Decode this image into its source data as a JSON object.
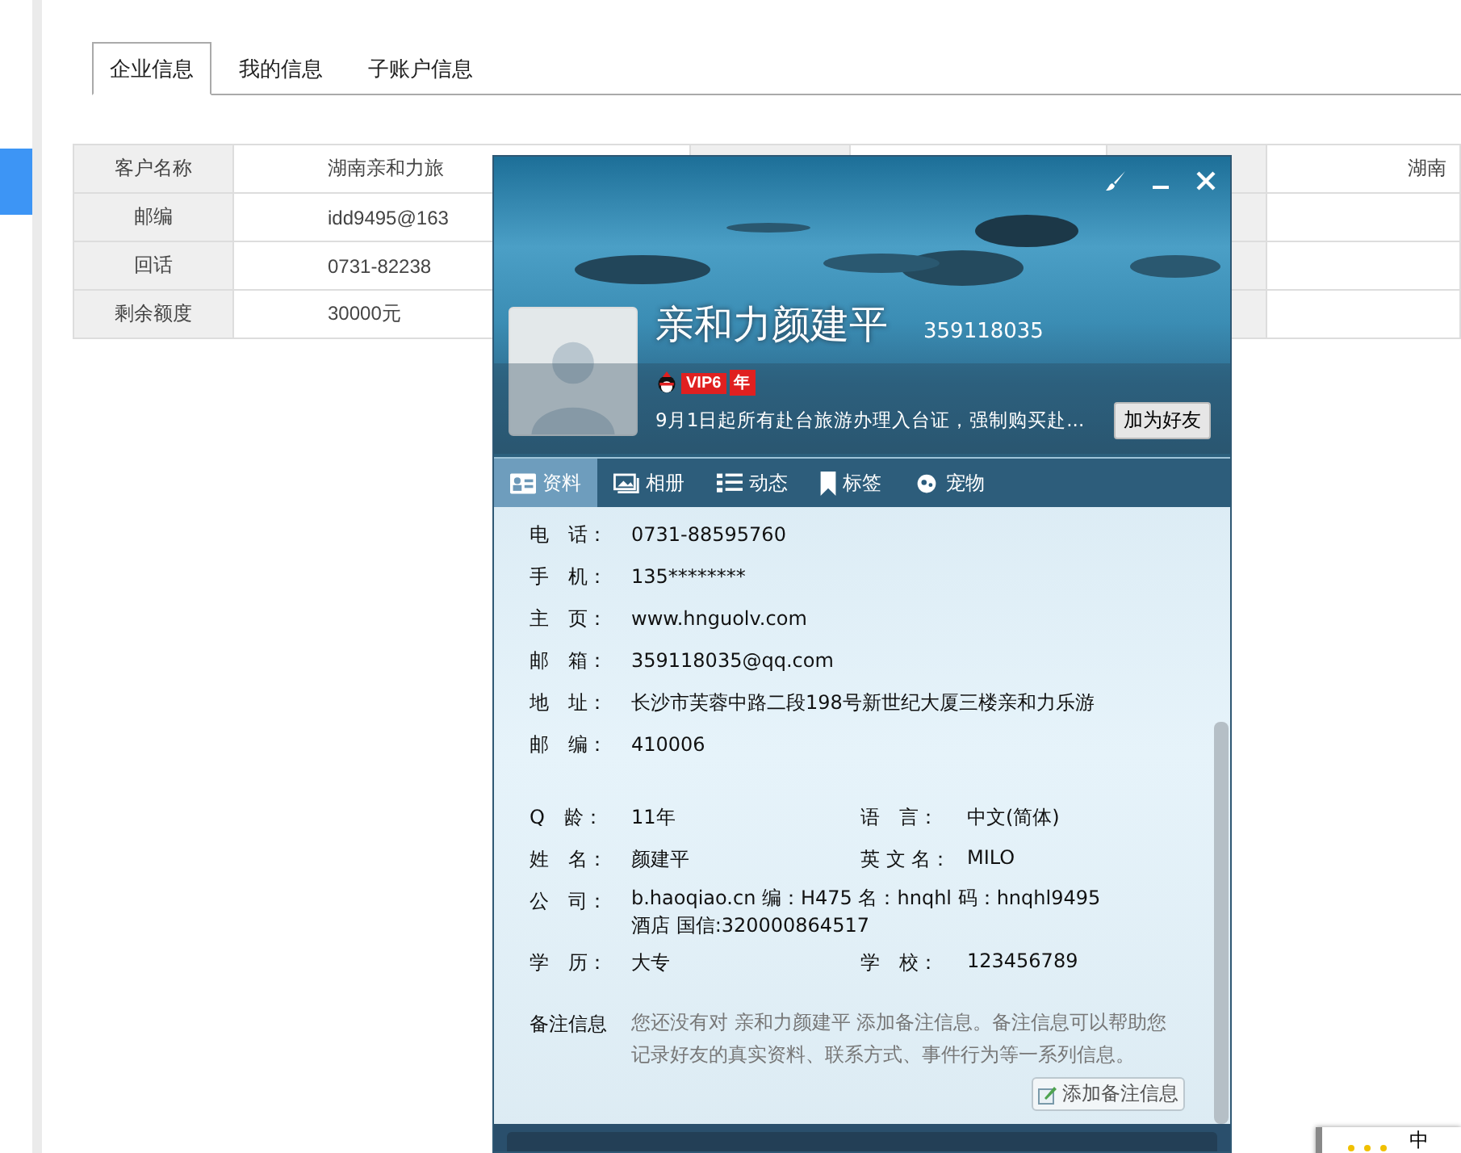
{
  "page_tabs": [
    {
      "label": "企业信息",
      "selected": true
    },
    {
      "label": "我的信息",
      "selected": false
    },
    {
      "label": "子账户信息",
      "selected": false
    }
  ],
  "sidebar": {
    "items": [
      {
        "selected": true
      }
    ]
  },
  "info_table": {
    "rows": [
      {
        "cells": [
          "客户名称",
          "湖南亲和力旅",
          "",
          "",
          "",
          "湖南"
        ]
      },
      {
        "cells": [
          "邮编",
          "idd9495@163",
          "",
          "",
          "",
          ""
        ]
      },
      {
        "cells": [
          "回话",
          "0731-82238",
          "",
          "",
          "",
          ""
        ]
      },
      {
        "cells": [
          "剩余额度",
          "30000元",
          "",
          "",
          "",
          ""
        ]
      }
    ]
  },
  "profile_window": {
    "nickname": "亲和力颜建平",
    "qq_number": "359118035",
    "vip": {
      "label": "VIP6",
      "suffix": "年"
    },
    "status": "9月1日起所有赴台旅游办理入台证，强制购买赴...",
    "add_friend": "加为好友",
    "tabs": [
      {
        "kind": "card",
        "label": "资料",
        "selected": true
      },
      {
        "kind": "photo",
        "label": "相册",
        "selected": false
      },
      {
        "kind": "list",
        "label": "动态",
        "selected": false
      },
      {
        "kind": "bookmark",
        "label": "标签",
        "selected": false
      },
      {
        "kind": "pet",
        "label": "宠物",
        "selected": false
      }
    ],
    "contact": [
      {
        "label": "电　话：",
        "value": "0731-88595760"
      },
      {
        "label": "手　机：",
        "value": "135********"
      },
      {
        "label": "主　页：",
        "value": "www.hnguolv.com"
      },
      {
        "label": "邮　箱：",
        "value": "359118035@qq.com"
      },
      {
        "label": "地　址：",
        "value": "长沙市芙蓉中路二段198号新世纪大厦三楼亲和力乐游"
      },
      {
        "label": "邮　编：",
        "value": "410006"
      }
    ],
    "details": [
      [
        {
          "label": "Q　龄：",
          "value": "11年"
        },
        {
          "label": "语　言：",
          "value": "中文(简体)"
        }
      ],
      [
        {
          "label": "姓　名：",
          "value": "颜建平"
        },
        {
          "label": "英 文 名：",
          "value": "MILO"
        }
      ],
      [
        {
          "label": "公　司：",
          "value": "b.haoqiao.cn  编：H475  名：hnqhl  码：hnqhl9495 酒店 国信:320000864517"
        }
      ],
      [
        {
          "label": "学　历：",
          "value": "大专"
        },
        {
          "label": "学　校：",
          "value": "123456789"
        }
      ]
    ],
    "remark": {
      "label": "备注信息",
      "text": "您还没有对 亲和力颜建平 添加备注信息。备注信息可以帮助您记录好友的真实资料、联系方式、事件行为等一系列信息。",
      "button": "添加备注信息"
    }
  },
  "corner_popup": {
    "text": "中"
  }
}
